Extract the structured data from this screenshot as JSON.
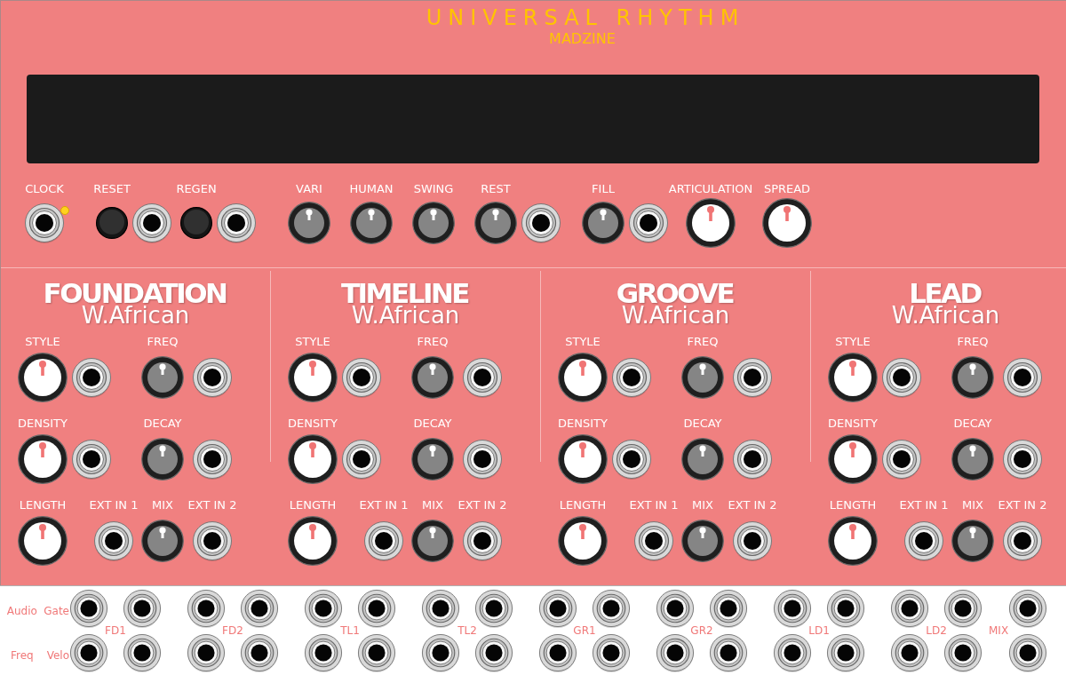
{
  "header": {
    "title": "UNIVERSAL RHYTHM",
    "brand": "MADZINE"
  },
  "controls": [
    {
      "label": "CLOCK",
      "items": [
        {
          "kind": "jack",
          "lit": true
        }
      ]
    },
    {
      "label": "RESET",
      "items": [
        {
          "kind": "button"
        },
        {
          "kind": "jack"
        }
      ]
    },
    {
      "label": "REGEN",
      "items": [
        {
          "kind": "button"
        },
        {
          "kind": "jack"
        }
      ]
    },
    {
      "label": "VARI",
      "items": [
        {
          "kind": "knob"
        }
      ]
    },
    {
      "label": "HUMAN",
      "items": [
        {
          "kind": "knob"
        }
      ]
    },
    {
      "label": "SWING",
      "items": [
        {
          "kind": "knob"
        }
      ]
    },
    {
      "label": "REST",
      "items": [
        {
          "kind": "knob"
        },
        {
          "kind": "jack"
        }
      ]
    },
    {
      "label": "FILL",
      "items": [
        {
          "kind": "knob"
        },
        {
          "kind": "jack"
        }
      ]
    },
    {
      "label": "ARTICULATION",
      "items": [
        {
          "kind": "knob_large"
        }
      ]
    },
    {
      "label": "SPREAD",
      "items": [
        {
          "kind": "knob_large"
        }
      ]
    }
  ],
  "sections": [
    {
      "title": "FOUNDATION",
      "style": "W.African",
      "rows": [
        [
          {
            "label": "STYLE",
            "kind": "knob_large"
          },
          {
            "kind": "jack"
          },
          {
            "label": "FREQ",
            "kind": "knob"
          },
          {
            "kind": "jack"
          }
        ],
        [
          {
            "label": "DENSITY",
            "kind": "knob_large"
          },
          {
            "kind": "jack"
          },
          {
            "label": "DECAY",
            "kind": "knob"
          },
          {
            "kind": "jack"
          }
        ],
        [
          {
            "label": "LENGTH",
            "kind": "knob_large"
          },
          {
            "label": "EXT IN 1",
            "kind": "jack"
          },
          {
            "label": "MIX",
            "kind": "knob"
          },
          {
            "label": "EXT IN 2",
            "kind": "jack"
          }
        ]
      ]
    },
    {
      "title": "TIMELINE",
      "style": "W.African",
      "rows": [
        [
          {
            "label": "STYLE",
            "kind": "knob_large"
          },
          {
            "kind": "jack"
          },
          {
            "label": "FREQ",
            "kind": "knob"
          },
          {
            "kind": "jack"
          }
        ],
        [
          {
            "label": "DENSITY",
            "kind": "knob_large"
          },
          {
            "kind": "jack"
          },
          {
            "label": "DECAY",
            "kind": "knob"
          },
          {
            "kind": "jack"
          }
        ],
        [
          {
            "label": "LENGTH",
            "kind": "knob_large"
          },
          {
            "label": "EXT IN 1",
            "kind": "jack"
          },
          {
            "label": "MIX",
            "kind": "knob"
          },
          {
            "label": "EXT IN 2",
            "kind": "jack"
          }
        ]
      ]
    },
    {
      "title": "GROOVE",
      "style": "W.African",
      "rows": [
        [
          {
            "label": "STYLE",
            "kind": "knob_large"
          },
          {
            "kind": "jack"
          },
          {
            "label": "FREQ",
            "kind": "knob"
          },
          {
            "kind": "jack"
          }
        ],
        [
          {
            "label": "DENSITY",
            "kind": "knob_large"
          },
          {
            "kind": "jack"
          },
          {
            "label": "DECAY",
            "kind": "knob"
          },
          {
            "kind": "jack"
          }
        ],
        [
          {
            "label": "LENGTH",
            "kind": "knob_large"
          },
          {
            "label": "EXT IN 1",
            "kind": "jack"
          },
          {
            "label": "MIX",
            "kind": "knob"
          },
          {
            "label": "EXT IN 2",
            "kind": "jack"
          }
        ]
      ]
    },
    {
      "title": "LEAD",
      "style": "W.African",
      "rows": [
        [
          {
            "label": "STYLE",
            "kind": "knob_large"
          },
          {
            "kind": "jack"
          },
          {
            "label": "FREQ",
            "kind": "knob"
          },
          {
            "kind": "jack"
          }
        ],
        [
          {
            "label": "DENSITY",
            "kind": "knob_large"
          },
          {
            "kind": "jack"
          },
          {
            "label": "DECAY",
            "kind": "knob"
          },
          {
            "kind": "jack"
          }
        ],
        [
          {
            "label": "LENGTH",
            "kind": "knob_large"
          },
          {
            "label": "EXT IN 1",
            "kind": "jack"
          },
          {
            "label": "MIX",
            "kind": "knob"
          },
          {
            "label": "EXT IN 2",
            "kind": "jack"
          }
        ]
      ]
    }
  ],
  "outputs": {
    "port_labels": [
      [
        "Audio",
        "Gate"
      ],
      [
        "Freq",
        "Velo"
      ]
    ],
    "groups": [
      {
        "label": "FD1",
        "kind": "pair"
      },
      {
        "label": "FD2",
        "kind": "pair"
      },
      {
        "label": "TL1",
        "kind": "pair"
      },
      {
        "label": "TL2",
        "kind": "pair"
      },
      {
        "label": "GR1",
        "kind": "pair"
      },
      {
        "label": "GR2",
        "kind": "pair"
      },
      {
        "label": "LD1",
        "kind": "pair"
      },
      {
        "label": "LD2",
        "kind": "pair"
      },
      {
        "label": "MIX",
        "kind": "single"
      }
    ]
  }
}
